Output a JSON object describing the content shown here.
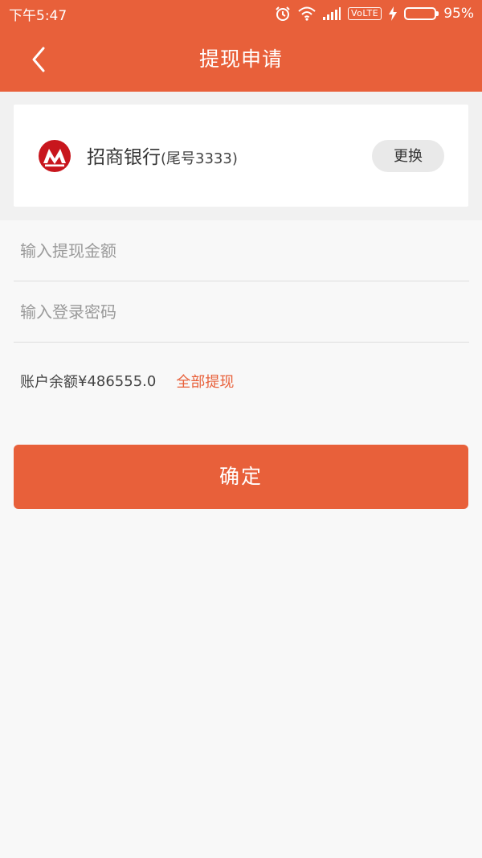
{
  "status_bar": {
    "time": "下午5:47",
    "network_label": "VoLTE",
    "battery_percent": "95%",
    "battery_level": 0.95,
    "icons": [
      "alarm-icon",
      "wifi-icon",
      "signal-icon",
      "charging-icon",
      "battery-icon"
    ]
  },
  "header": {
    "title": "提现申请",
    "back_icon": "chevron-left-icon"
  },
  "bank_card": {
    "bank_name": "招商银行",
    "card_tail": "(尾号3333)",
    "logo_icon": "cmb-bank-logo",
    "change_label": "更换"
  },
  "form": {
    "amount_placeholder": "输入提现金额",
    "amount_value": "",
    "password_placeholder": "输入登录密码",
    "password_value": ""
  },
  "balance": {
    "label": "账户余额",
    "value": "¥486555.0",
    "withdraw_all_label": "全部提现"
  },
  "actions": {
    "confirm_label": "确定"
  },
  "colors": {
    "primary": "#e8603a",
    "background": "#f8f8f8",
    "battery_green": "#5bd11f",
    "bank_logo_red": "#c8161d"
  }
}
